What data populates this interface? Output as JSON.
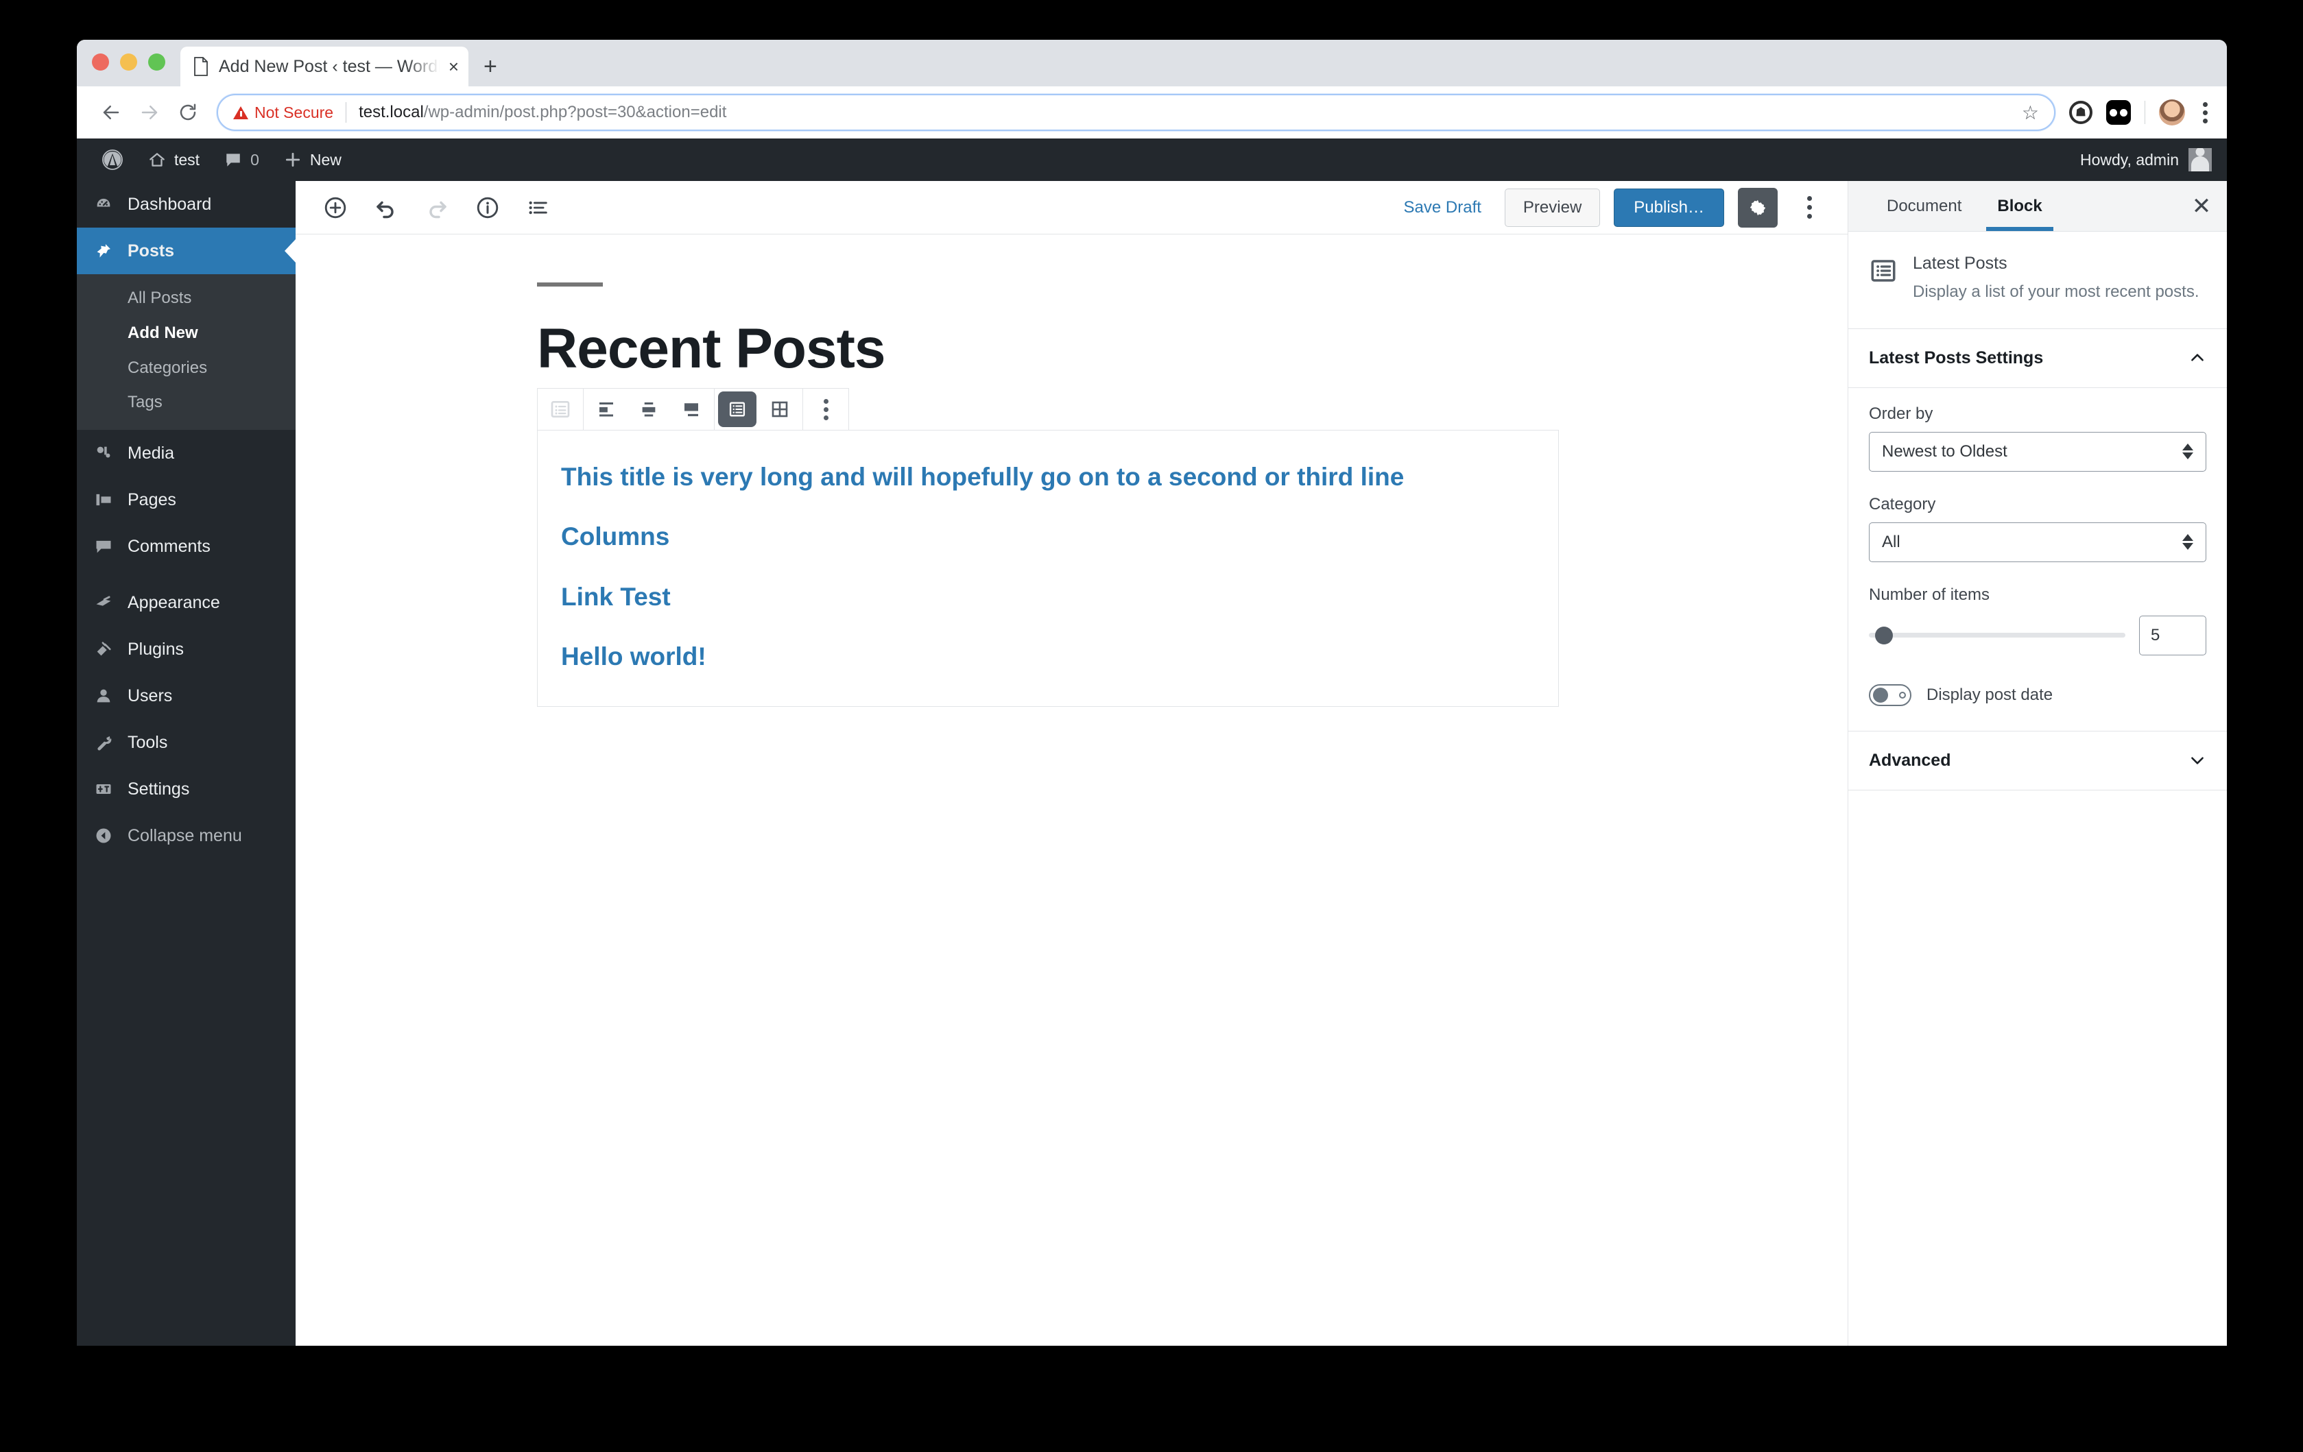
{
  "browser": {
    "tab": {
      "title": "Add New Post ‹ test — WordPr",
      "favicon": "document-icon",
      "close": "×"
    },
    "new_tab_label": "+",
    "nav": {
      "back": "←",
      "forward": "→",
      "reload": "↻"
    },
    "omnibox": {
      "security_label": "Not Secure",
      "url_host": "test.local",
      "url_path": "/wp-admin/post.php?post=30&action=edit",
      "bookmark_icon": "☆"
    }
  },
  "adminbar": {
    "wp_logo": "wordpress-logo-icon",
    "site_name": "test",
    "comment_count": "0",
    "new_label": "New",
    "howdy": "Howdy, admin"
  },
  "sidebar": {
    "items": [
      {
        "label": "Dashboard",
        "icon": "dashboard-icon"
      },
      {
        "label": "Posts",
        "icon": "pin-icon"
      },
      {
        "label": "Media",
        "icon": "media-icon"
      },
      {
        "label": "Pages",
        "icon": "pages-icon"
      },
      {
        "label": "Comments",
        "icon": "comment-icon"
      },
      {
        "label": "Appearance",
        "icon": "brush-icon"
      },
      {
        "label": "Plugins",
        "icon": "plug-icon"
      },
      {
        "label": "Users",
        "icon": "user-icon"
      },
      {
        "label": "Tools",
        "icon": "wrench-icon"
      },
      {
        "label": "Settings",
        "icon": "settings-icon"
      },
      {
        "label": "Collapse menu",
        "icon": "collapse-icon"
      }
    ],
    "submenu": [
      {
        "label": "All Posts",
        "current": false
      },
      {
        "label": "Add New",
        "current": true
      },
      {
        "label": "Categories",
        "current": false
      },
      {
        "label": "Tags",
        "current": false
      }
    ]
  },
  "editor_header": {
    "tools": [
      {
        "name": "add-block-icon",
        "state": "enabled"
      },
      {
        "name": "undo-icon",
        "state": "enabled"
      },
      {
        "name": "redo-icon",
        "state": "disabled"
      },
      {
        "name": "info-icon",
        "state": "enabled"
      },
      {
        "name": "block-navigation-icon",
        "state": "enabled"
      }
    ],
    "save_draft_label": "Save Draft",
    "preview_label": "Preview",
    "publish_label": "Publish…",
    "settings_gear": "gear-icon",
    "more_menu": "kebab-icon"
  },
  "post": {
    "title": "Recent Posts",
    "block_toolbar": [
      {
        "name": "block-type-list-icon",
        "active": false,
        "muted": true
      },
      {
        "name": "align-left-icon",
        "active": false
      },
      {
        "name": "align-center-icon",
        "active": false
      },
      {
        "name": "align-right-icon",
        "active": false
      },
      {
        "name": "list-view-icon",
        "active": true
      },
      {
        "name": "grid-view-icon",
        "active": false
      },
      {
        "name": "more-options-icon",
        "active": false
      }
    ],
    "latest_posts": [
      "This title is very long and will hopefully go on to a second or third line",
      "Columns",
      "Link Test",
      "Hello world!"
    ]
  },
  "block_sidebar": {
    "tabs": [
      {
        "label": "Document",
        "active": false
      },
      {
        "label": "Block",
        "active": true
      }
    ],
    "close_icon": "✕",
    "block": {
      "icon": "latest-posts-icon",
      "name": "Latest Posts",
      "description": "Display a list of your most recent posts."
    },
    "settings_panel": {
      "title": "Latest Posts Settings",
      "chevron": "∧",
      "order_by": {
        "label": "Order by",
        "value": "Newest to Oldest"
      },
      "category": {
        "label": "Category",
        "value": "All"
      },
      "number_of_items": {
        "label": "Number of items",
        "value": "5"
      },
      "display_post_date": {
        "label": "Display post date",
        "enabled": false
      }
    },
    "advanced_panel": {
      "title": "Advanced",
      "chevron": "∨"
    }
  },
  "colors": {
    "wp_blue": "#2c79b3",
    "admin_dark": "#23282d",
    "submenu_dark": "#32373c",
    "not_secure_red": "#d93025"
  }
}
